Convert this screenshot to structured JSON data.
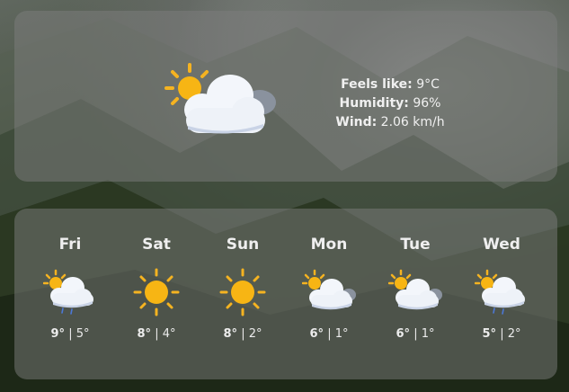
{
  "current": {
    "icon": "partly-cloudy-rain-icon",
    "feels_like_label": "Feels like:",
    "feels_like_value": "9°C",
    "humidity_label": "Humidity:",
    "humidity_value": "96%",
    "wind_label": "Wind:",
    "wind_value": "2.06 km/h"
  },
  "forecast": [
    {
      "day": "Fri",
      "icon": "sun-cloud-rain-icon",
      "high": "9°",
      "sep": "|",
      "low": "5°"
    },
    {
      "day": "Sat",
      "icon": "sun-icon",
      "high": "8°",
      "sep": "|",
      "low": "4°"
    },
    {
      "day": "Sun",
      "icon": "sun-icon",
      "high": "8°",
      "sep": "|",
      "low": "2°"
    },
    {
      "day": "Mon",
      "icon": "sun-cloud-icon",
      "high": "6°",
      "sep": "|",
      "low": "1°"
    },
    {
      "day": "Tue",
      "icon": "sun-cloud-icon",
      "high": "6°",
      "sep": "|",
      "low": "1°"
    },
    {
      "day": "Wed",
      "icon": "sun-cloud-rain-icon",
      "high": "5°",
      "sep": "|",
      "low": "2°"
    }
  ],
  "colors": {
    "sun": "#f7b514",
    "sun_ray": "#f5b321",
    "cloud": "#f3f6fb",
    "cloud_shade": "#c9d3e6",
    "dark_cloud": "#8a929e",
    "rain": "#4c78d8",
    "panel": "rgba(125,125,125,0.50)"
  }
}
